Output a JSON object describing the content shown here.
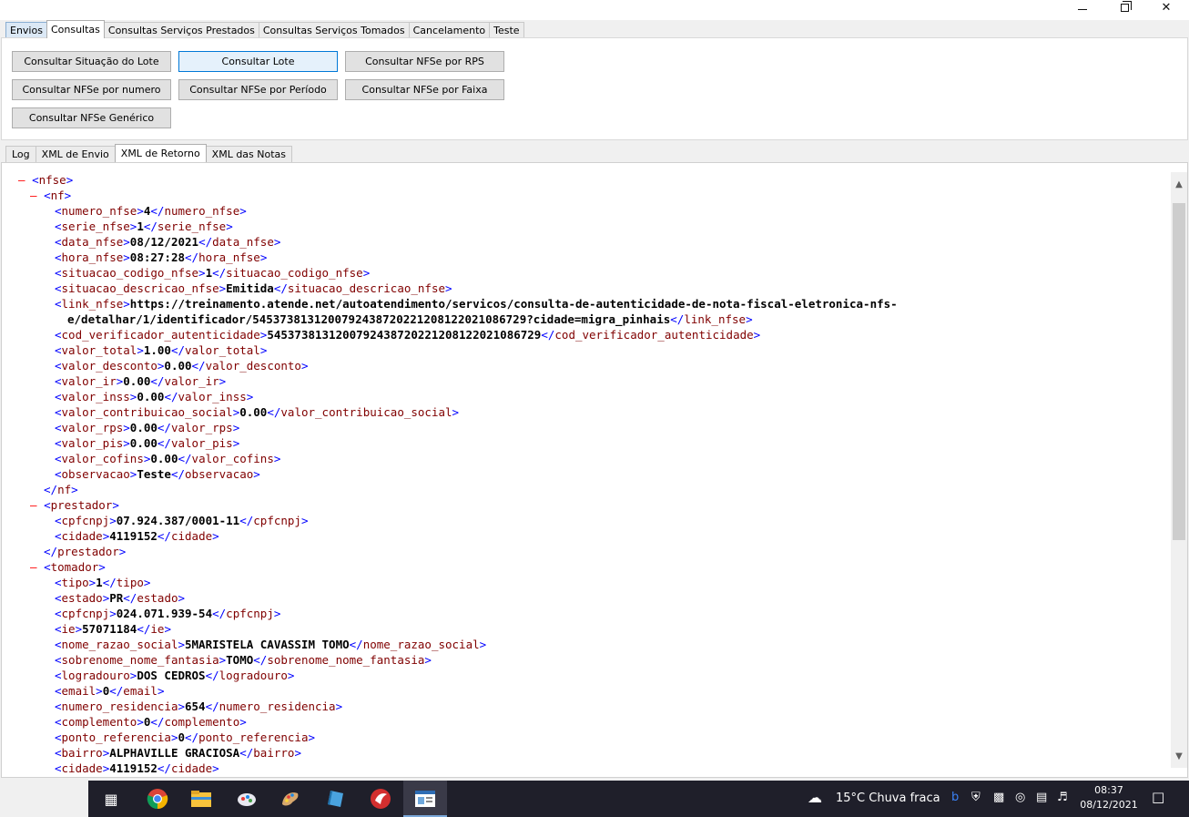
{
  "window": {
    "minimize": "—",
    "maximize": "❐",
    "close": "✕"
  },
  "top_tabs": [
    "Envios",
    "Consultas",
    "Consultas Serviços Prestados",
    "Consultas Serviços Tomados",
    "Cancelamento",
    "Teste"
  ],
  "buttons": {
    "consultar_situacao_lote": "Consultar Situação do Lote",
    "consultar_lote": "Consultar Lote",
    "consultar_nfse_rps": "Consultar NFSe por RPS",
    "consultar_nfse_numero": "Consultar NFSe por numero",
    "consultar_nfse_periodo": "Consultar NFSe por Período",
    "consultar_nfse_faixa": "Consultar NFSe por Faixa",
    "consultar_nfse_generico": "Consultar NFSe Genérico"
  },
  "bottom_tabs": [
    "Log",
    "XML de Envio",
    "XML de Retorno",
    "XML das Notas"
  ],
  "xml": {
    "nfse": "nfse",
    "nf": "nf",
    "nf_fields": [
      {
        "tag": "numero_nfse",
        "value": "4"
      },
      {
        "tag": "serie_nfse",
        "value": "1"
      },
      {
        "tag": "data_nfse",
        "value": "08/12/2021"
      },
      {
        "tag": "hora_nfse",
        "value": "08:27:28"
      },
      {
        "tag": "situacao_codigo_nfse",
        "value": "1"
      },
      {
        "tag": "situacao_descricao_nfse",
        "value": "Emitida"
      }
    ],
    "link_tag": "link_nfse",
    "link_line1": "https://treinamento.atende.net/autoatendimento/servicos/consulta-de-autenticidade-de-nota-fiscal-eletronica-nfs-",
    "link_line2": "e/detalhar/1/identificador/5453738131200792438720221208122021086729?cidade=migra_pinhais",
    "nf_fields2": [
      {
        "tag": "cod_verificador_autenticidade",
        "value": "5453738131200792438720221208122021086729"
      },
      {
        "tag": "valor_total",
        "value": "1.00"
      },
      {
        "tag": "valor_desconto",
        "value": "0.00"
      },
      {
        "tag": "valor_ir",
        "value": "0.00"
      },
      {
        "tag": "valor_inss",
        "value": "0.00"
      },
      {
        "tag": "valor_contribuicao_social",
        "value": "0.00"
      },
      {
        "tag": "valor_rps",
        "value": "0.00"
      },
      {
        "tag": "valor_pis",
        "value": "0.00"
      },
      {
        "tag": "valor_cofins",
        "value": "0.00"
      },
      {
        "tag": "observacao",
        "value": "Teste"
      }
    ],
    "prestador": "prestador",
    "prestador_fields": [
      {
        "tag": "cpfcnpj",
        "value": "07.924.387/0001-11"
      },
      {
        "tag": "cidade",
        "value": "4119152"
      }
    ],
    "tomador": "tomador",
    "tomador_fields": [
      {
        "tag": "tipo",
        "value": "1"
      },
      {
        "tag": "estado",
        "value": "PR"
      },
      {
        "tag": "cpfcnpj",
        "value": "024.071.939-54"
      },
      {
        "tag": "ie",
        "value": "57071184"
      },
      {
        "tag": "nome_razao_social",
        "value": "5MARISTELA CAVASSIM TOMO"
      },
      {
        "tag": "sobrenome_nome_fantasia",
        "value": "TOMO"
      },
      {
        "tag": "logradouro",
        "value": "DOS CEDROS"
      },
      {
        "tag": "email",
        "value": "0"
      },
      {
        "tag": "numero_residencia",
        "value": "654"
      },
      {
        "tag": "complemento",
        "value": "0"
      },
      {
        "tag": "ponto_referencia",
        "value": "0"
      },
      {
        "tag": "bairro",
        "value": "ALPHAVILLE GRACIOSA"
      },
      {
        "tag": "cidade",
        "value": "4119152"
      }
    ]
  },
  "taskbar": {
    "weather": "15°C  Chuva fraca",
    "time": "08:37",
    "date": "08/12/2021"
  }
}
